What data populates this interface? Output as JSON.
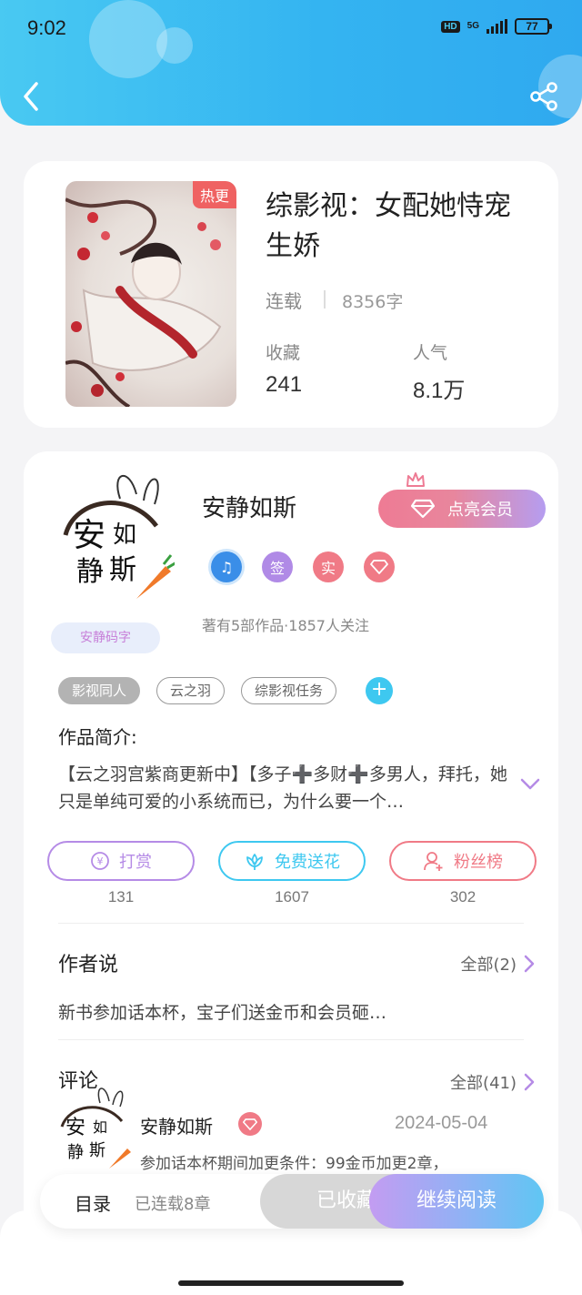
{
  "status_bar": {
    "time": "9:02",
    "hd": "HD",
    "network": "5G",
    "battery": "77"
  },
  "book": {
    "badge": "热更",
    "title": "综影视：女配她恃宠生娇",
    "status": "连载",
    "words": "8356字",
    "favorites_label": "收藏",
    "favorites_value": "241",
    "popularity_label": "人气",
    "popularity_value": "8.1万"
  },
  "author": {
    "name": "安静如斯",
    "vip_button": "点亮会员",
    "badges": [
      {
        "icon": "music-medal-icon",
        "color": "#3a8ee8"
      },
      {
        "text": "签",
        "color": "#b08ae6"
      },
      {
        "text": "实",
        "color": "#f07a86"
      },
      {
        "icon": "diamond-icon",
        "color": "#f07a86"
      }
    ],
    "meta": "著有5部作品·1857人关注",
    "avatar_tag": "安静码字"
  },
  "tags": [
    "影视同人",
    "云之羽",
    "综影视任务"
  ],
  "intro": {
    "label": "作品简介:",
    "text": "【云之羽宫紫商更新中】【多子➕多财➕多男人，拜托，她只是单纯可爱的小系统而已，为什么要一个…"
  },
  "actions": [
    {
      "label": "打赏",
      "count": "131",
      "color": "#b58be6",
      "icon": "coin-icon"
    },
    {
      "label": "免费送花",
      "count": "1607",
      "color": "#3ec8f0",
      "icon": "flower-icon"
    },
    {
      "label": "粉丝榜",
      "count": "302",
      "color": "#f07a86",
      "icon": "fan-icon"
    }
  ],
  "author_says": {
    "title": "作者说",
    "more": "全部(2)",
    "text": "新书参加话本杯，宝子们送金币和会员砸…"
  },
  "comments": {
    "title": "评论",
    "more": "全部(41)",
    "first": {
      "name": "安静如斯",
      "date": "2024-05-04",
      "text": "参加话本杯期间加更条件：99金币加更2章，"
    }
  },
  "bottom_bar": {
    "toc": "目录",
    "toc_count": "已连载8章",
    "collected": "已收藏",
    "continue": "继续阅读"
  },
  "colors": {
    "header_blue": "#34b4f1",
    "accent_purple": "#b58be6",
    "accent_pink": "#f07a86",
    "accent_cyan": "#3ec8f0"
  }
}
